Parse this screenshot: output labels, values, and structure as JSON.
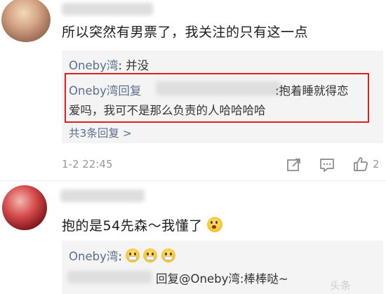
{
  "comment1": {
    "text": "所以突然有男票了，我关注的只有这一点",
    "time": "1-2 22:45",
    "replies": {
      "r1_user": "Oneby湾",
      "r1_text": ": 并没",
      "r2_user": "Oneby湾回复",
      "r2_text_a": ":抱着睡就得恋",
      "r2_text_b": "爱吗，我可不是那么负责的人哈哈哈哈",
      "more": "共3条回复 >"
    },
    "actions": {
      "share_icon": "share-icon",
      "comment_icon": "comment-icon",
      "like_icon": "like-icon",
      "like_count": "2"
    }
  },
  "comment2": {
    "text": "抱的是54先森～我懂了",
    "replies": {
      "r1_user": "Oneby湾",
      "r1_text": ":",
      "r2_text": "回复@Oneby湾:棒棒哒~"
    }
  },
  "watermark": "头条"
}
